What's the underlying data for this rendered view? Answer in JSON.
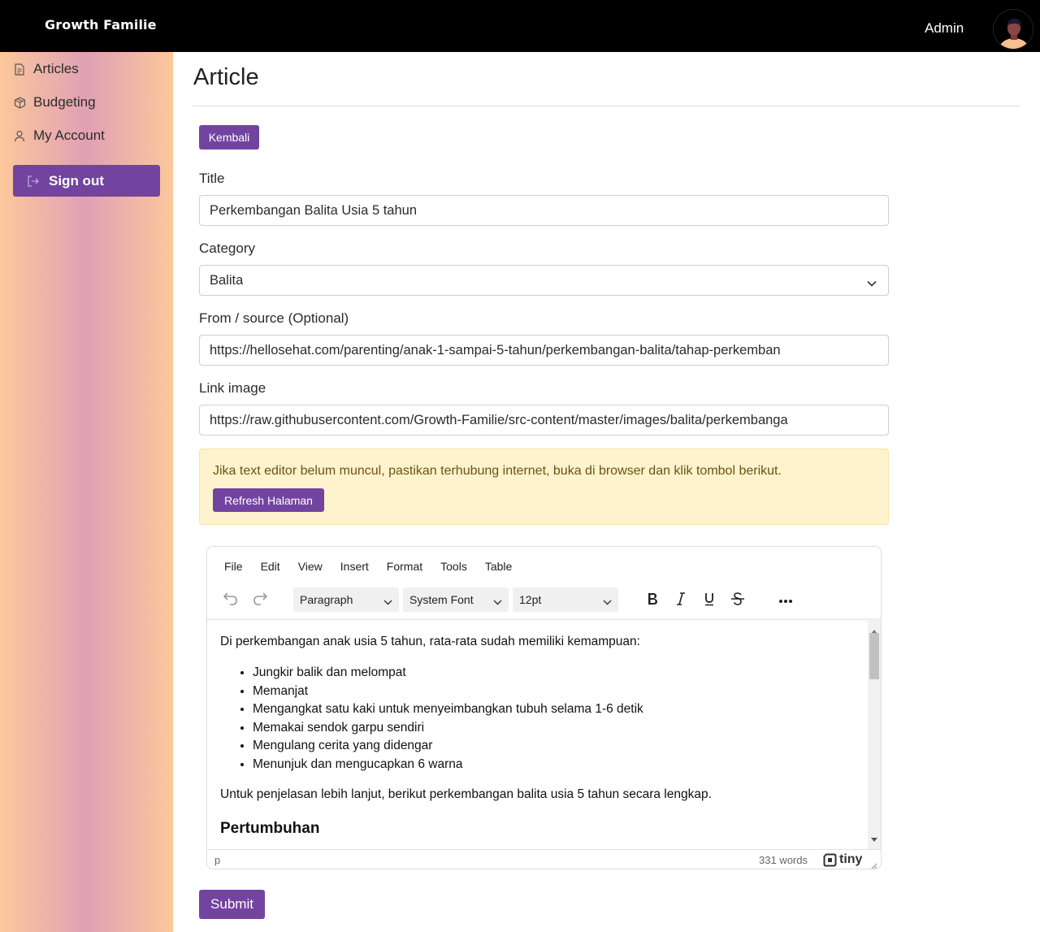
{
  "header": {
    "brand": "Growth Familie",
    "user_name": "Admin"
  },
  "sidebar": {
    "items": [
      {
        "label": "Articles",
        "icon": "document-icon"
      },
      {
        "label": "Budgeting",
        "icon": "cube-icon"
      },
      {
        "label": "My Account",
        "icon": "user-icon"
      }
    ],
    "signout_label": "Sign out"
  },
  "page": {
    "title": "Article",
    "back_label": "Kembali"
  },
  "form": {
    "title_label": "Title",
    "title_value": "Perkembangan Balita Usia 5 tahun",
    "category_label": "Category",
    "category_value": "Balita",
    "source_label": "From / source (Optional)",
    "source_value": "https://hellosehat.com/parenting/anak-1-sampai-5-tahun/perkembangan-balita/tahap-perkemban",
    "image_label": "Link image",
    "image_value": "https://raw.githubusercontent.com/Growth-Familie/src-content/master/images/balita/perkembanga",
    "submit_label": "Submit"
  },
  "alert": {
    "message": "Jika text editor belum muncul, pastikan terhubung internet, buka di browser dan klik tombol berikut.",
    "button_label": "Refresh Halaman"
  },
  "editor": {
    "menu": [
      "File",
      "Edit",
      "View",
      "Insert",
      "Format",
      "Tools",
      "Table"
    ],
    "block_format": "Paragraph",
    "font_family": "System Font",
    "font_size": "12pt",
    "content": {
      "intro": "Di perkembangan anak usia 5 tahun, rata-rata sudah memiliki kemampuan:",
      "list": [
        "Jungkir balik dan melompat",
        "Memanjat",
        "Mengangkat satu kaki untuk menyeimbangkan tubuh selama 1-6 detik",
        "Memakai sendok garpu sendiri",
        "Mengulang cerita yang didengar",
        "Menunjuk dan mengucapkan 6 warna"
      ],
      "after": "Untuk penjelasan lebih lanjut, berikut perkembangan balita usia 5 tahun secara lengkap.",
      "heading": "Pertumbuhan"
    },
    "status_path": "p",
    "word_count": "331 words",
    "brand": "tiny"
  },
  "colors": {
    "accent": "#7244a0",
    "topbar": "#000000",
    "alert_bg": "#fef3cd"
  }
}
